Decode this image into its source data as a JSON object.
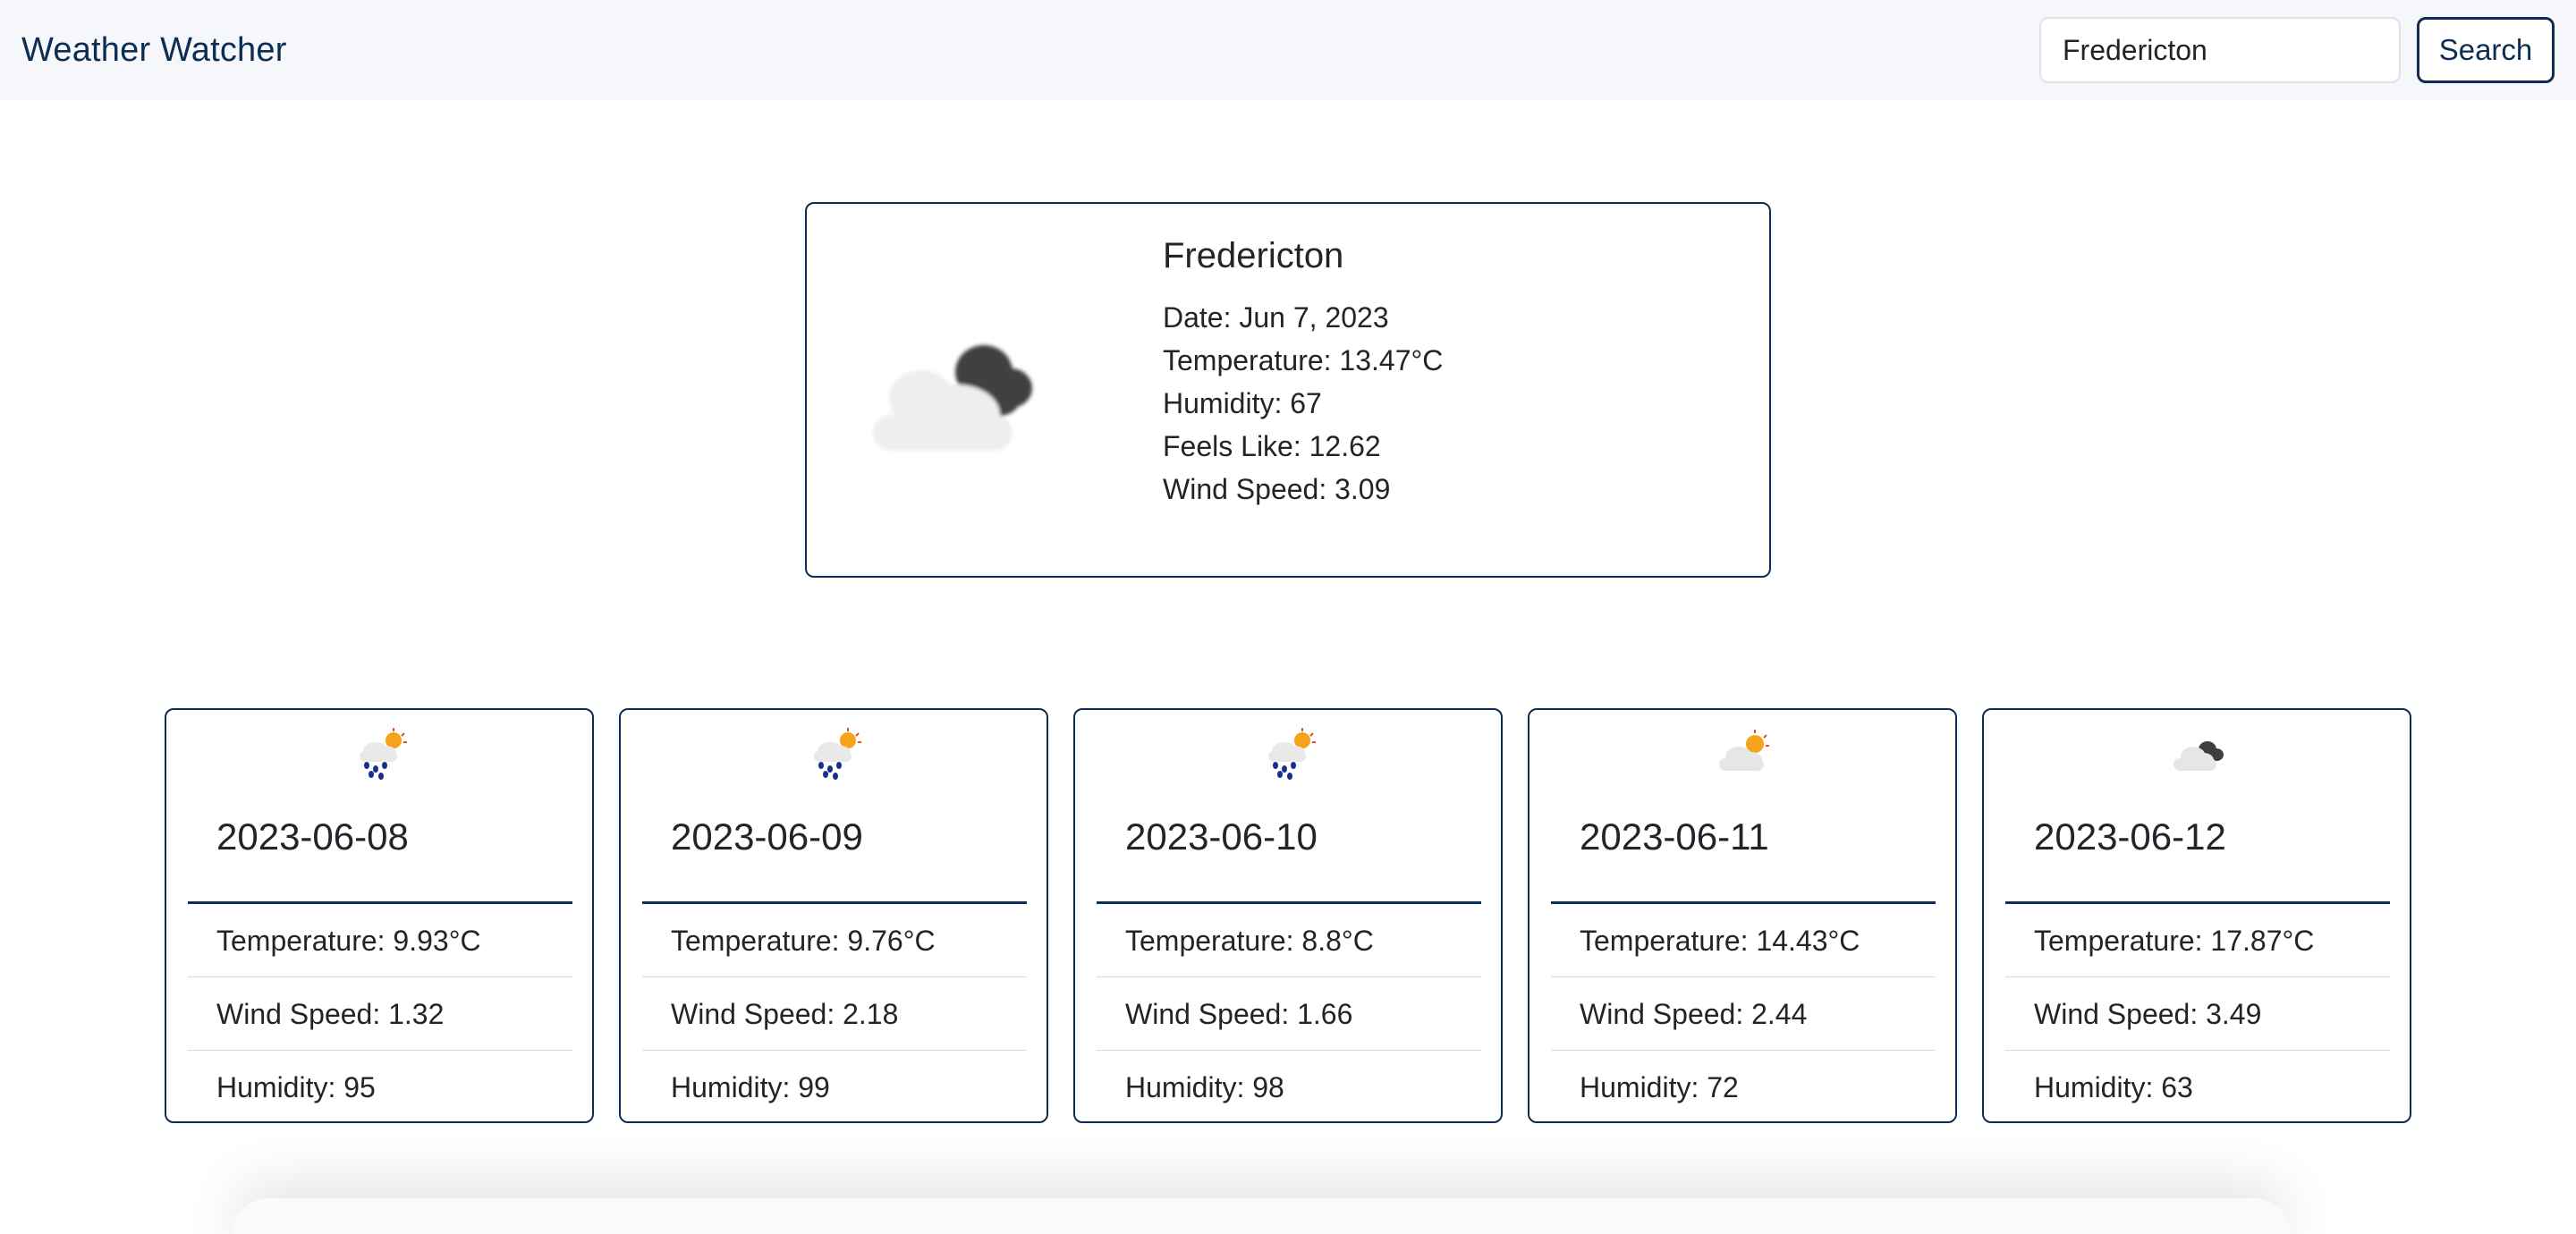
{
  "app": {
    "title": "Weather Watcher"
  },
  "search": {
    "value": "Fredericton",
    "button_label": "Search"
  },
  "current": {
    "city": "Fredericton",
    "icon": "cloudy-icon",
    "date": "Date: Jun 7, 2023",
    "temperature": "Temperature: 13.47°C",
    "humidity": "Humidity: 67",
    "feels_like": "Feels Like: 12.62",
    "wind_speed": "Wind Speed: 3.09"
  },
  "forecast": [
    {
      "date": "2023-06-08",
      "icon": "rain-sun-icon",
      "temperature": "Temperature: 9.93°C",
      "wind_speed": "Wind Speed: 1.32",
      "humidity": "Humidity: 95"
    },
    {
      "date": "2023-06-09",
      "icon": "rain-sun-icon",
      "temperature": "Temperature: 9.76°C",
      "wind_speed": "Wind Speed: 2.18",
      "humidity": "Humidity: 99"
    },
    {
      "date": "2023-06-10",
      "icon": "rain-sun-icon",
      "temperature": "Temperature: 8.8°C",
      "wind_speed": "Wind Speed: 1.66",
      "humidity": "Humidity: 98"
    },
    {
      "date": "2023-06-11",
      "icon": "cloud-sun-icon",
      "temperature": "Temperature: 14.43°C",
      "wind_speed": "Wind Speed: 2.44",
      "humidity": "Humidity: 72"
    },
    {
      "date": "2023-06-12",
      "icon": "cloudy-icon",
      "temperature": "Temperature: 17.87°C",
      "wind_speed": "Wind Speed: 3.49",
      "humidity": "Humidity: 63"
    }
  ],
  "colors": {
    "accent": "#0d2d52",
    "navbar_bg": "#f5f7fa",
    "text": "#212529"
  }
}
